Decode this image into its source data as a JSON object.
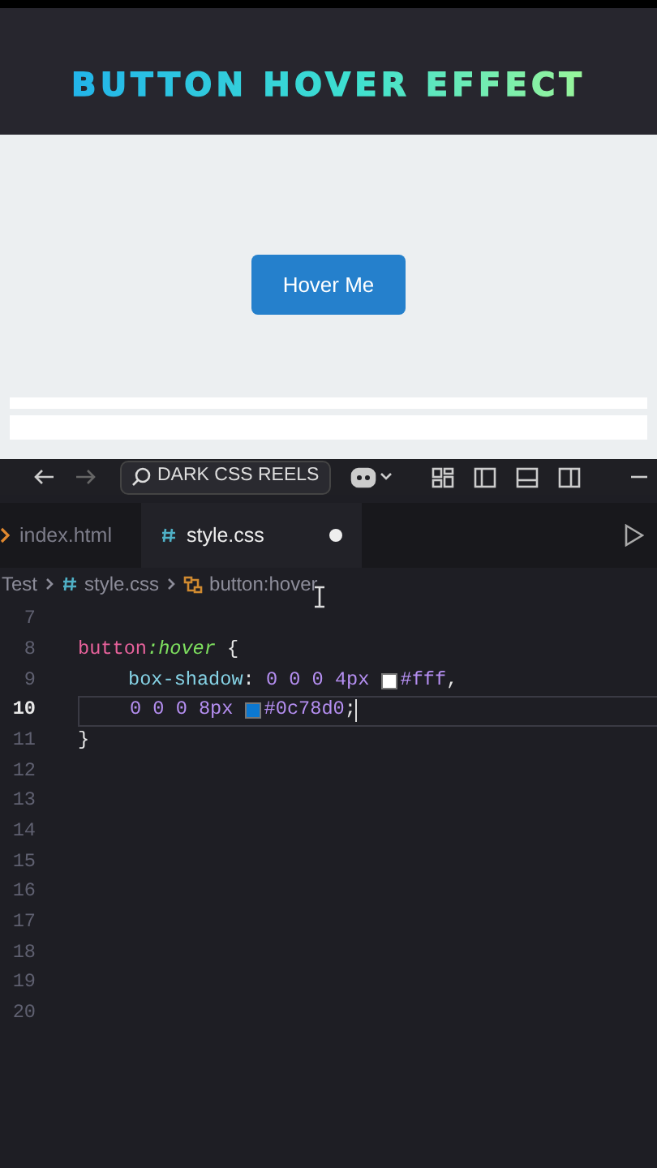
{
  "header": {
    "title": "BUTTON HOVER EFFECT"
  },
  "preview": {
    "button": "Hover Me"
  },
  "toolbar": {
    "search": "DARK CSS REELS"
  },
  "tabs": [
    {
      "label": "index.html",
      "kind": "html",
      "selected": false,
      "modified": false
    },
    {
      "label": "style.css",
      "kind": "css",
      "selected": true,
      "modified": true
    }
  ],
  "breadcrumbs": [
    {
      "label": "Test",
      "kind": "folder"
    },
    {
      "label": "style.css",
      "kind": "css"
    },
    {
      "label": "button:hover",
      "kind": "symbol"
    }
  ],
  "editor": {
    "lines": [
      {
        "number": "7",
        "current": false
      },
      {
        "number": "8",
        "current": false,
        "tokens": [
          {
            "kind": "selector",
            "text": "button"
          },
          {
            "kind": "pseudo",
            "text": ":hover"
          },
          {
            "kind": "punct",
            "text": " {"
          }
        ]
      },
      {
        "number": "9",
        "current": false,
        "indent": true,
        "tokens": [
          {
            "kind": "property",
            "text": "box-shadow"
          },
          {
            "kind": "punct",
            "text": ": "
          },
          {
            "kind": "number",
            "text": "0 0 0 4px "
          },
          {
            "kind": "swatch",
            "color": "#ffffff"
          },
          {
            "kind": "number",
            "text": "#fff"
          },
          {
            "kind": "punct",
            "text": ","
          }
        ]
      },
      {
        "number": "10",
        "current": true,
        "indent": true,
        "tokens": [
          {
            "kind": "number",
            "text": "0 0 0 8px "
          },
          {
            "kind": "swatch",
            "color": "#0c78d0"
          },
          {
            "kind": "number",
            "text": "#0c78d0"
          },
          {
            "kind": "punct",
            "text": ";"
          }
        ]
      },
      {
        "number": "11",
        "current": false,
        "tokens": [
          {
            "kind": "punct",
            "text": "}"
          }
        ]
      },
      {
        "number": "12",
        "current": false
      },
      {
        "number": "13",
        "current": false
      },
      {
        "number": "14",
        "current": false
      },
      {
        "number": "15",
        "current": false
      },
      {
        "number": "16",
        "current": false
      },
      {
        "number": "17",
        "current": false
      },
      {
        "number": "18",
        "current": false
      },
      {
        "number": "19",
        "current": false
      },
      {
        "number": "20",
        "current": false
      }
    ]
  }
}
